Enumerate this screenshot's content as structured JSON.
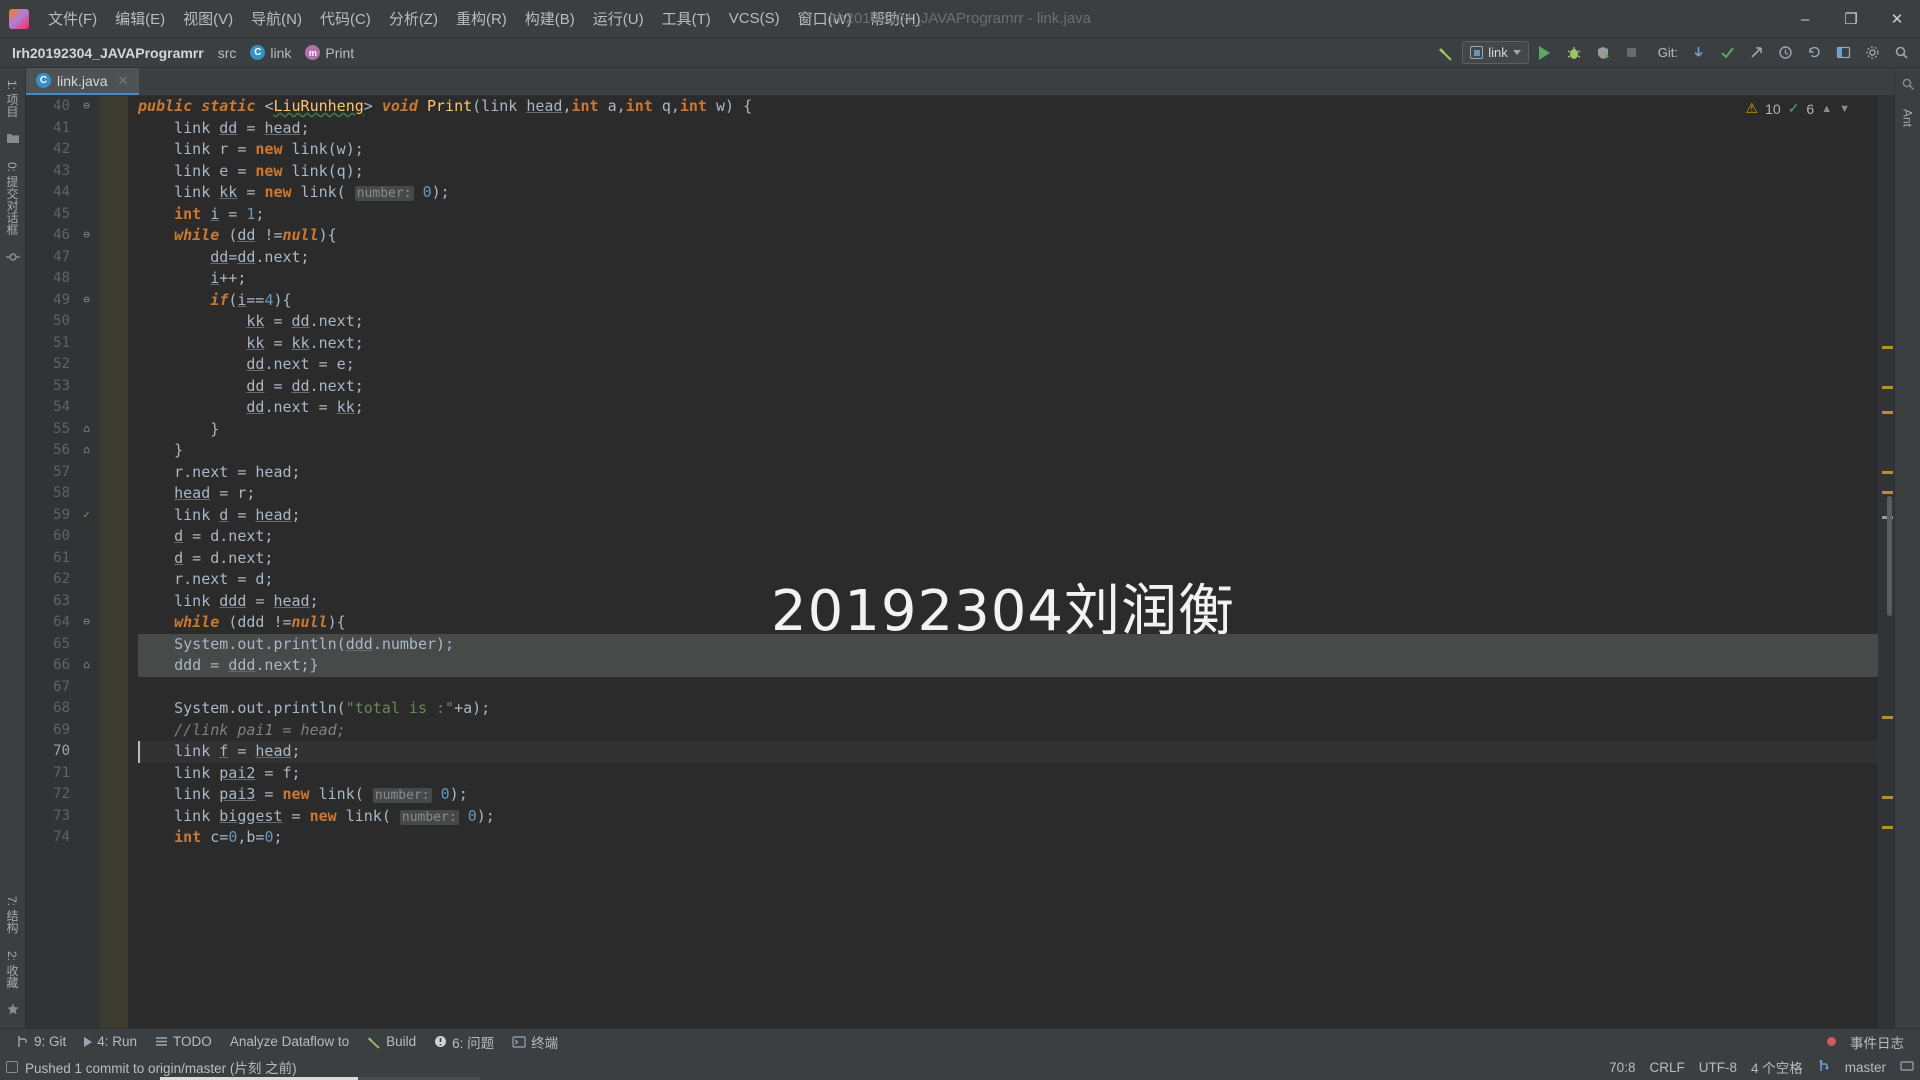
{
  "window": {
    "title": "lrh20192304_JAVAProgramrr - link.java",
    "logo_glyph": "IJ",
    "minimize": "–",
    "maximize": "❐",
    "close": "✕"
  },
  "menu": {
    "items": [
      {
        "label": "文件(F)",
        "name": "menu-file"
      },
      {
        "label": "编辑(E)",
        "name": "menu-edit"
      },
      {
        "label": "视图(V)",
        "name": "menu-view"
      },
      {
        "label": "导航(N)",
        "name": "menu-navigate"
      },
      {
        "label": "代码(C)",
        "name": "menu-code"
      },
      {
        "label": "分析(Z)",
        "name": "menu-analyze"
      },
      {
        "label": "重构(R)",
        "name": "menu-refactor"
      },
      {
        "label": "构建(B)",
        "name": "menu-build"
      },
      {
        "label": "运行(U)",
        "name": "menu-run"
      },
      {
        "label": "工具(T)",
        "name": "menu-tools"
      },
      {
        "label": "VCS(S)",
        "name": "menu-vcs"
      },
      {
        "label": "窗口(W)",
        "name": "menu-window"
      },
      {
        "label": "帮助(H)",
        "name": "menu-help"
      }
    ]
  },
  "navbar": {
    "breadcrumbs": [
      {
        "label": "lrh20192304_JAVAProgramrr",
        "icon": "",
        "name": "breadcrumb-project"
      },
      {
        "label": "src",
        "icon": "",
        "name": "breadcrumb-src"
      },
      {
        "label": "link",
        "icon": "C",
        "name": "breadcrumb-class-link"
      },
      {
        "label": "Print",
        "icon": "m",
        "name": "breadcrumb-method-print"
      }
    ],
    "build_icon": "⤵",
    "run_config": "link",
    "git_label": "Git:",
    "icons": {
      "run": "run-icon",
      "debug": "debug-icon",
      "coverage": "coverage-icon",
      "stop": "stop-icon",
      "update": "update-project-icon",
      "commit": "commit-icon",
      "push": "push-icon",
      "history": "history-icon",
      "rollback": "rollback-icon",
      "layout": "layout-icon",
      "settings": "settings-icon",
      "search": "search-icon"
    }
  },
  "left_strip": {
    "project": "1: 项目",
    "commit": "0: 提交对话框",
    "structure": "7: 结构",
    "favorites": "2: 收藏"
  },
  "right_strip": {
    "ant": "Ant"
  },
  "tabs": [
    {
      "label": "link.java",
      "icon": "C",
      "name": "tab-link-java",
      "active": true
    }
  ],
  "editor": {
    "inspection": {
      "warnings": "10",
      "checks": "6"
    },
    "watermark": "20192304刘润衡",
    "first_line": 40,
    "lines": [
      {
        "n": 40,
        "tokens": [
          {
            "t": "public static ",
            "c": "kw"
          },
          {
            "t": "<",
            "c": "ch"
          },
          {
            "t": "LiuRunheng",
            "c": "gen-u"
          },
          {
            "t": "> ",
            "c": "ch"
          },
          {
            "t": "void ",
            "c": "kw"
          },
          {
            "t": "Print",
            "c": "fn"
          },
          {
            "t": "(link ",
            "c": "id"
          },
          {
            "t": "head",
            "c": "u"
          },
          {
            "t": ",",
            "c": "ch"
          },
          {
            "t": "int ",
            "c": "kw2"
          },
          {
            "t": "a,",
            "c": "id"
          },
          {
            "t": "int ",
            "c": "kw2"
          },
          {
            "t": "q,",
            "c": "id"
          },
          {
            "t": "int ",
            "c": "kw2"
          },
          {
            "t": "w) {",
            "c": "id"
          }
        ],
        "fold": "collapse"
      },
      {
        "n": 41,
        "tokens": [
          {
            "t": "    link ",
            "c": "id"
          },
          {
            "t": "dd",
            "c": "u"
          },
          {
            "t": " = ",
            "c": "ch"
          },
          {
            "t": "head",
            "c": "u"
          },
          {
            "t": ";",
            "c": "ch"
          }
        ]
      },
      {
        "n": 42,
        "tokens": [
          {
            "t": "    link r = ",
            "c": "id"
          },
          {
            "t": "new ",
            "c": "kw2"
          },
          {
            "t": "link(w);",
            "c": "id"
          }
        ]
      },
      {
        "n": 43,
        "tokens": [
          {
            "t": "    link e = ",
            "c": "id"
          },
          {
            "t": "new ",
            "c": "kw2"
          },
          {
            "t": "link(q);",
            "c": "id"
          }
        ]
      },
      {
        "n": 44,
        "tokens": [
          {
            "t": "    link ",
            "c": "id"
          },
          {
            "t": "kk",
            "c": "u"
          },
          {
            "t": " = ",
            "c": "ch"
          },
          {
            "t": "new ",
            "c": "kw2"
          },
          {
            "t": "link( ",
            "c": "id"
          },
          {
            "t": "number:",
            "c": "hint"
          },
          {
            "t": " ",
            "c": "ch"
          },
          {
            "t": "0",
            "c": "num"
          },
          {
            "t": ");",
            "c": "ch"
          }
        ]
      },
      {
        "n": 45,
        "tokens": [
          {
            "t": "    ",
            "c": "ch"
          },
          {
            "t": "int ",
            "c": "kw2"
          },
          {
            "t": "i",
            "c": "u"
          },
          {
            "t": " = ",
            "c": "ch"
          },
          {
            "t": "1",
            "c": "num"
          },
          {
            "t": ";",
            "c": "ch"
          }
        ]
      },
      {
        "n": 46,
        "tokens": [
          {
            "t": "    ",
            "c": "ch"
          },
          {
            "t": "while ",
            "c": "kw"
          },
          {
            "t": "(",
            "c": "ch"
          },
          {
            "t": "dd",
            "c": "u"
          },
          {
            "t": " !=",
            "c": "ch"
          },
          {
            "t": "null",
            "c": "kw"
          },
          {
            "t": "){",
            "c": "ch"
          }
        ],
        "fold": "collapse"
      },
      {
        "n": 47,
        "tokens": [
          {
            "t": "        ",
            "c": "ch"
          },
          {
            "t": "dd",
            "c": "u"
          },
          {
            "t": "=",
            "c": "ch"
          },
          {
            "t": "dd",
            "c": "u"
          },
          {
            "t": ".next;",
            "c": "ch"
          }
        ]
      },
      {
        "n": 48,
        "tokens": [
          {
            "t": "        ",
            "c": "ch"
          },
          {
            "t": "i",
            "c": "u"
          },
          {
            "t": "++;",
            "c": "ch"
          }
        ]
      },
      {
        "n": 49,
        "tokens": [
          {
            "t": "        ",
            "c": "ch"
          },
          {
            "t": "if",
            "c": "kw"
          },
          {
            "t": "(",
            "c": "ch"
          },
          {
            "t": "i",
            "c": "u"
          },
          {
            "t": "==",
            "c": "ch"
          },
          {
            "t": "4",
            "c": "num"
          },
          {
            "t": "){",
            "c": "ch"
          }
        ],
        "fold": "collapse"
      },
      {
        "n": 50,
        "tokens": [
          {
            "t": "            ",
            "c": "ch"
          },
          {
            "t": "kk",
            "c": "u"
          },
          {
            "t": " = ",
            "c": "ch"
          },
          {
            "t": "dd",
            "c": "u"
          },
          {
            "t": ".next;",
            "c": "ch"
          }
        ]
      },
      {
        "n": 51,
        "tokens": [
          {
            "t": "            ",
            "c": "ch"
          },
          {
            "t": "kk",
            "c": "u"
          },
          {
            "t": " = ",
            "c": "ch"
          },
          {
            "t": "kk",
            "c": "u"
          },
          {
            "t": ".next;",
            "c": "ch"
          }
        ]
      },
      {
        "n": 52,
        "tokens": [
          {
            "t": "            ",
            "c": "ch"
          },
          {
            "t": "dd",
            "c": "u"
          },
          {
            "t": ".next = e;",
            "c": "ch"
          }
        ]
      },
      {
        "n": 53,
        "tokens": [
          {
            "t": "            ",
            "c": "ch"
          },
          {
            "t": "dd",
            "c": "u"
          },
          {
            "t": " = ",
            "c": "ch"
          },
          {
            "t": "dd",
            "c": "u"
          },
          {
            "t": ".next;",
            "c": "ch"
          }
        ]
      },
      {
        "n": 54,
        "tokens": [
          {
            "t": "            ",
            "c": "ch"
          },
          {
            "t": "dd",
            "c": "u"
          },
          {
            "t": ".next = ",
            "c": "ch"
          },
          {
            "t": "kk",
            "c": "u"
          },
          {
            "t": ";",
            "c": "ch"
          }
        ]
      },
      {
        "n": 55,
        "tokens": [
          {
            "t": "        }",
            "c": "ch"
          }
        ],
        "fold": "end"
      },
      {
        "n": 56,
        "tokens": [
          {
            "t": "    }",
            "c": "ch"
          }
        ],
        "fold": "end"
      },
      {
        "n": 57,
        "tokens": [
          {
            "t": "    r.next = head;",
            "c": "ch"
          }
        ]
      },
      {
        "n": 58,
        "tokens": [
          {
            "t": "    ",
            "c": "ch"
          },
          {
            "t": "head",
            "c": "u"
          },
          {
            "t": " = r;",
            "c": "ch"
          }
        ]
      },
      {
        "n": 59,
        "tokens": [
          {
            "t": "    link ",
            "c": "id"
          },
          {
            "t": "d",
            "c": "u"
          },
          {
            "t": " = ",
            "c": "ch"
          },
          {
            "t": "head",
            "c": "u"
          },
          {
            "t": ";",
            "c": "ch"
          }
        ],
        "fold": "check"
      },
      {
        "n": 60,
        "tokens": [
          {
            "t": "    ",
            "c": "ch"
          },
          {
            "t": "d",
            "c": "u"
          },
          {
            "t": " = d.next;",
            "c": "ch"
          }
        ]
      },
      {
        "n": 61,
        "tokens": [
          {
            "t": "    ",
            "c": "ch"
          },
          {
            "t": "d",
            "c": "u"
          },
          {
            "t": " = d.next;",
            "c": "ch"
          }
        ]
      },
      {
        "n": 62,
        "tokens": [
          {
            "t": "    r.next = d;",
            "c": "ch"
          }
        ]
      },
      {
        "n": 63,
        "tokens": [
          {
            "t": "    link ",
            "c": "id"
          },
          {
            "t": "ddd",
            "c": "u"
          },
          {
            "t": " = ",
            "c": "ch"
          },
          {
            "t": "head",
            "c": "u"
          },
          {
            "t": ";",
            "c": "ch"
          }
        ]
      },
      {
        "n": 64,
        "tokens": [
          {
            "t": "    ",
            "c": "ch"
          },
          {
            "t": "while ",
            "c": "kw"
          },
          {
            "t": "(ddd !=",
            "c": "ch"
          },
          {
            "t": "null",
            "c": "kw"
          },
          {
            "t": "){",
            "c": "ch"
          }
        ],
        "fold": "collapse"
      },
      {
        "n": 65,
        "tokens": [
          {
            "t": "    System.out.println(",
            "c": "ch"
          },
          {
            "t": "ddd",
            "c": "u"
          },
          {
            "t": ".number);",
            "c": "ch"
          }
        ],
        "err": true
      },
      {
        "n": 66,
        "tokens": [
          {
            "t": "    ddd = ",
            "c": "ch"
          },
          {
            "t": "ddd",
            "c": "u"
          },
          {
            "t": ".next;}",
            "c": "ch"
          }
        ],
        "err": true,
        "fold": "end"
      },
      {
        "n": 67,
        "tokens": [
          {
            "t": "",
            "c": "ch"
          }
        ]
      },
      {
        "n": 68,
        "tokens": [
          {
            "t": "    System.out.println(",
            "c": "ch"
          },
          {
            "t": "\"total is :\"",
            "c": "str"
          },
          {
            "t": "+a);",
            "c": "ch"
          }
        ]
      },
      {
        "n": 69,
        "tokens": [
          {
            "t": "    //link pai1 = head;",
            "c": "cmt"
          }
        ]
      },
      {
        "n": 70,
        "tokens": [
          {
            "t": "    link ",
            "c": "id"
          },
          {
            "t": "f",
            "c": "u"
          },
          {
            "t": " = ",
            "c": "ch"
          },
          {
            "t": "head",
            "c": "u"
          },
          {
            "t": ";",
            "c": "ch"
          }
        ],
        "cursor": true
      },
      {
        "n": 71,
        "tokens": [
          {
            "t": "    link ",
            "c": "id"
          },
          {
            "t": "pai2",
            "c": "u"
          },
          {
            "t": " = f;",
            "c": "ch"
          }
        ]
      },
      {
        "n": 72,
        "tokens": [
          {
            "t": "    link ",
            "c": "id"
          },
          {
            "t": "pai3",
            "c": "u"
          },
          {
            "t": " = ",
            "c": "ch"
          },
          {
            "t": "new ",
            "c": "kw2"
          },
          {
            "t": "link( ",
            "c": "id"
          },
          {
            "t": "number:",
            "c": "hint"
          },
          {
            "t": " ",
            "c": "ch"
          },
          {
            "t": "0",
            "c": "num"
          },
          {
            "t": ");",
            "c": "ch"
          }
        ]
      },
      {
        "n": 73,
        "tokens": [
          {
            "t": "    link ",
            "c": "id"
          },
          {
            "t": "biggest",
            "c": "u"
          },
          {
            "t": " = ",
            "c": "ch"
          },
          {
            "t": "new ",
            "c": "kw2"
          },
          {
            "t": "link( ",
            "c": "id"
          },
          {
            "t": "number:",
            "c": "hint"
          },
          {
            "t": " ",
            "c": "ch"
          },
          {
            "t": "0",
            "c": "num"
          },
          {
            "t": ");",
            "c": "ch"
          }
        ]
      },
      {
        "n": 74,
        "tokens": [
          {
            "t": "    ",
            "c": "ch"
          },
          {
            "t": "int ",
            "c": "kw2"
          },
          {
            "t": "c=",
            "c": "id"
          },
          {
            "t": "0",
            "c": "num"
          },
          {
            "t": ",b=",
            "c": "id"
          },
          {
            "t": "0",
            "c": "num"
          },
          {
            "t": ";",
            "c": "ch"
          }
        ]
      }
    ]
  },
  "bottom_tools": [
    {
      "label": "9: Git",
      "name": "tool-git",
      "icon": "git-icon"
    },
    {
      "label": "4: Run",
      "name": "tool-run",
      "icon": "run-icon"
    },
    {
      "label": "TODO",
      "name": "tool-todo",
      "icon": "todo-icon"
    },
    {
      "label": "Analyze Dataflow to",
      "name": "tool-analyze-dataflow",
      "icon": ""
    },
    {
      "label": "Build",
      "name": "tool-build",
      "icon": "build-icon"
    },
    {
      "label": "6: 问题",
      "name": "tool-problems",
      "icon": "problems-icon"
    },
    {
      "label": "终端",
      "name": "tool-terminal",
      "icon": "terminal-icon"
    }
  ],
  "bottom_right": {
    "event_log": "事件日志"
  },
  "status": {
    "message": "Pushed 1 commit to origin/master (片刻 之前)",
    "caret": "70:8",
    "line_sep": "CRLF",
    "encoding": "UTF-8",
    "indent": "4 个空格",
    "branch": "master"
  },
  "colors": {
    "accent_green": "#59a869",
    "accent_blue": "#4a88c7",
    "warning": "#d6a100",
    "background": "#2b2b2b",
    "chrome": "#3c3f41"
  }
}
